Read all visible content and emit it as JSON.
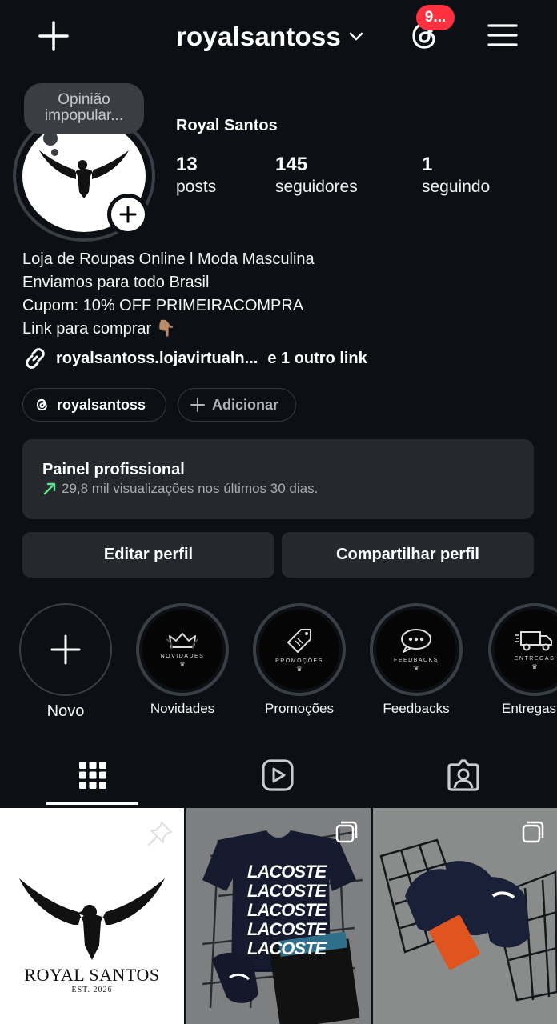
{
  "header": {
    "username": "royalsantoss",
    "notification_count": "9..."
  },
  "profile": {
    "note": "Opinião impopular...",
    "full_name": "Royal Santos",
    "stats": [
      {
        "value": "13",
        "label": "posts"
      },
      {
        "value": "145",
        "label": "seguidores"
      },
      {
        "value": "1",
        "label": "seguindo"
      }
    ],
    "bio": [
      "Loja de Roupas Online l Moda Masculina",
      "Enviamos para todo Brasil",
      "Cupom: 10% OFF PRIMEIRACOMPRA",
      "Link para comprar 👇🏽"
    ],
    "link": {
      "text": "royalsantoss.lojavirtualn...",
      "extra": "e 1 outro link"
    },
    "chips": {
      "threads": "royalsantoss",
      "add": "Adicionar"
    }
  },
  "dashboard": {
    "title": "Painel profissional",
    "subtitle": "29,8 mil visualizações nos últimos 30 dias.",
    "trend_color": "#5fe08a"
  },
  "actions": {
    "edit": "Editar perfil",
    "share": "Compartilhar perfil"
  },
  "highlights": [
    {
      "label": "Novo",
      "icon": "plus-icon"
    },
    {
      "label": "Novidades",
      "caption": "NOVIDADES",
      "icon": "crown-icon"
    },
    {
      "label": "Promoções",
      "caption": "PROMOÇÕES",
      "icon": "price-tag-icon"
    },
    {
      "label": "Feedbacks",
      "caption": "FEEDBACKS",
      "icon": "chat-bubbles-icon"
    },
    {
      "label": "Entregas",
      "caption": "ENTREGAS",
      "icon": "delivery-truck-icon"
    }
  ],
  "tabs": [
    {
      "name": "posts",
      "icon": "grid-icon",
      "active": true
    },
    {
      "name": "reels",
      "icon": "reels-icon",
      "active": false
    },
    {
      "name": "tagged",
      "icon": "tagged-person-icon",
      "active": false
    }
  ],
  "posts": [
    {
      "brand": "ROYAL SANTOS",
      "est": "EST. 2026",
      "pinned": true
    },
    {
      "print": [
        "LACOSTE",
        "LACOSTE",
        "LACOSTE",
        "LACOSTE",
        "LACOSTE"
      ],
      "multi": true
    },
    {
      "multi": true
    }
  ],
  "colors": {
    "background": "#0c1014",
    "surface": "#25292e",
    "badge": "#ff3040"
  }
}
